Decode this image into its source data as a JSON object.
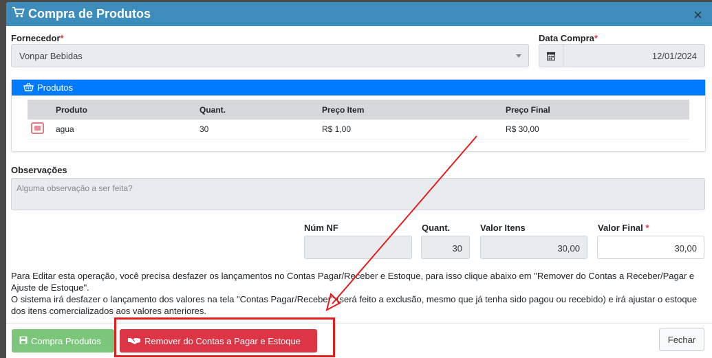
{
  "modal": {
    "title": "Compra de Produtos",
    "close_label": "×"
  },
  "form": {
    "supplier_label": "Fornecedor",
    "supplier_value": "Vonpar Bebidas",
    "date_label": "Data Compra",
    "date_value": "12/01/2024",
    "required_mark": "*"
  },
  "products_panel": {
    "title": "Produtos",
    "columns": [
      "Produto",
      "Quant.",
      "Preço Item",
      "Preço Final"
    ],
    "rows": [
      {
        "produto": "agua",
        "quant": "30",
        "preco_item": "R$ 1,00",
        "preco_final": "R$ 30,00"
      }
    ]
  },
  "notes": {
    "label": "Observações",
    "placeholder": "Alguma observação a ser feita?"
  },
  "totals": {
    "nf_label": "Núm NF",
    "nf_value": "",
    "quant_label": "Quant.",
    "quant_value": "30",
    "valor_itens_label": "Valor Itens",
    "valor_itens_value": "30,00",
    "valor_final_label": "Valor Final",
    "valor_final_value": "30,00"
  },
  "info": {
    "line1": "Para Editar esta operação, você precisa desfazer os lançamentos no Contas Pagar/Receber e Estoque, para isso clique abaixo em \"Remover do Contas a Receber/Pagar e Ajuste de Estoque\".",
    "line2": "O sistema irá desfazer o lançamento dos valores na tela \"Contas Pagar/Receber\" (será feito a exclusão, mesmo que já tenha sido pagou ou recebido) e irá ajustar o estoque dos itens comercializados aos valores anteriores."
  },
  "footer": {
    "save_label": "Compra Produtos",
    "remove_label": "Remover do Contas a Pagar e Estoque",
    "close_label": "Fechar"
  },
  "colors": {
    "header": "#3c8dbc",
    "panel_header": "#007bff",
    "danger": "#dc3545",
    "success": "#5cb85c",
    "annotation": "#e51c1c"
  }
}
